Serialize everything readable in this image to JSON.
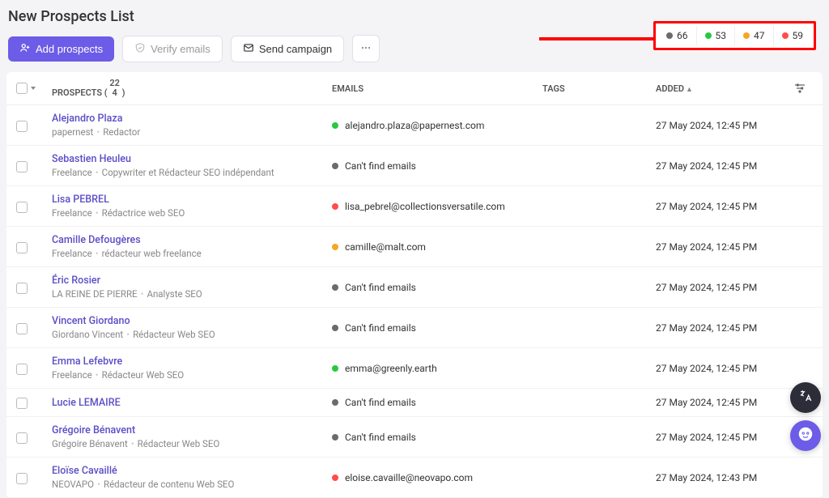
{
  "page": {
    "title": "New Prospects List"
  },
  "toolbar": {
    "add_prospects": "Add prospects",
    "verify_emails": "Verify emails",
    "send_campaign": "Send campaign"
  },
  "status": {
    "gray": "66",
    "green": "53",
    "yellow": "47",
    "red": "59"
  },
  "columns": {
    "prospects": "PROSPECTS",
    "prospects_count_top": "22",
    "prospects_count_bottom": "4",
    "emails": "EMAILS",
    "tags": "TAGS",
    "added": "ADDED"
  },
  "rows": [
    {
      "name": "Alejandro Plaza",
      "company": "papernest",
      "role": "Redactor",
      "email": "alejandro.plaza@papernest.com",
      "email_status": "green",
      "added": "27 May 2024, 12:45 PM"
    },
    {
      "name": "Sebastien Heuleu",
      "company": "Freelance",
      "role": "Copywriter et Rédacteur SEO indépendant",
      "email": "Can't find emails",
      "email_status": "gray",
      "added": "27 May 2024, 12:45 PM"
    },
    {
      "name": "Lisa PEBREL",
      "company": "Freelance",
      "role": "Rédactrice web SEO",
      "email": "lisa_pebrel@collectionsversatile.com",
      "email_status": "red",
      "added": "27 May 2024, 12:45 PM"
    },
    {
      "name": "Camille Defougères",
      "company": "Freelance",
      "role": "rédacteur web freelance",
      "email": "camille@malt.com",
      "email_status": "yellow",
      "added": "27 May 2024, 12:45 PM"
    },
    {
      "name": "Éric Rosier",
      "company": "LA REINE DE PIERRE",
      "role": "Analyste SEO",
      "email": "Can't find emails",
      "email_status": "gray",
      "added": "27 May 2024, 12:45 PM"
    },
    {
      "name": "Vincent Giordano",
      "company": "Giordano Vincent",
      "role": "Rédacteur Web SEO",
      "email": "Can't find emails",
      "email_status": "gray",
      "added": "27 May 2024, 12:45 PM"
    },
    {
      "name": "Emma Lefebvre",
      "company": "Freelance",
      "role": "Rédacteur Web SEO",
      "email": "emma@greenly.earth",
      "email_status": "green",
      "added": "27 May 2024, 12:45 PM"
    },
    {
      "name": "Lucie LEMAIRE",
      "company": "",
      "role": "",
      "email": "Can't find emails",
      "email_status": "gray",
      "added": "27 May 2024, 12:45 PM"
    },
    {
      "name": "Grégoire Bénavent",
      "company": "Grégoire Bénavent",
      "role": "Rédacteur Web SEO",
      "email": "Can't find emails",
      "email_status": "gray",
      "added": "27 May 2024, 12:45 PM"
    },
    {
      "name": "Eloïse Cavaillé",
      "company": "NEOVAPO",
      "role": "Rédacteur de contenu Web SEO",
      "email": "eloise.cavaille@neovapo.com",
      "email_status": "red",
      "added": "27 May 2024, 12:43 PM"
    }
  ]
}
